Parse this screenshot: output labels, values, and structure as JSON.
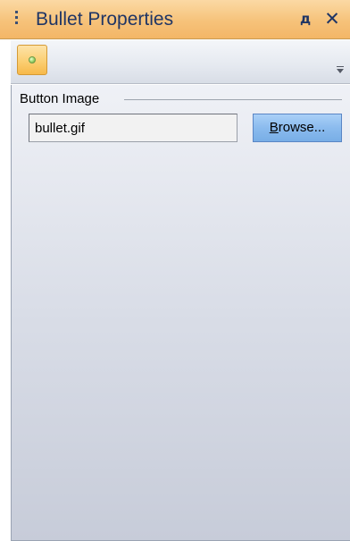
{
  "window": {
    "title": "Bullet Properties",
    "pin_glyph": "д",
    "close_glyph": "✕",
    "icons": {
      "grip": "drag-grip-icon",
      "pin": "pin-icon",
      "close": "close-icon",
      "overflow": "toolbar-overflow-icon",
      "bullet": "green-bullet-icon"
    }
  },
  "toolbar": {
    "items": [
      {
        "icon": "green-bullet-icon",
        "selected": true
      }
    ]
  },
  "button_image": {
    "group_label": "Button Image",
    "file_value": "bullet.gif",
    "browse": {
      "mnemonic": "B",
      "rest": "rowse..."
    }
  },
  "colors": {
    "title_bar": "#f6c27a",
    "title_text": "#1f3565",
    "browse_button": "#8bbbee",
    "content_background": "#d9dde7"
  }
}
